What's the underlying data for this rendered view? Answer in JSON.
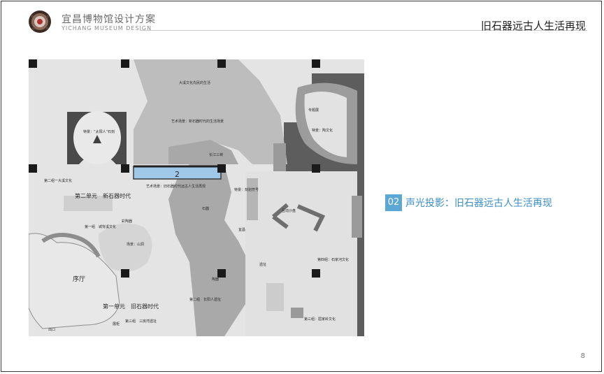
{
  "header": {
    "brand_cn": "宜昌博物馆设计方案",
    "brand_en": "YICHANG MUSEUM DESIGN",
    "title": "旧石器远古人生活再现"
  },
  "floorplan": {
    "labels": {
      "lobby": "序厅",
      "unit1": "第一单元　旧石器时代",
      "unit2": "第二单元　新石器时代",
      "unit2_sec1": "第二组一大溪文化",
      "site_marker": "2",
      "big_scene": "特景：“太阳人”石刻",
      "scene_carving": "特景：刻划符号",
      "scene_quju": "特景：陶文化",
      "group1_sec": "第一组　城背溪文化",
      "group3_sec": "第三组　三房湾遗址",
      "group3b": "第三组：屈家岭文化",
      "group5": "第四组：石家河文化",
      "art_scene": "艺术场景：旧石器时代远古人生活再现",
      "art_scene2": "艺术场景：新石器时代的生活场景",
      "changyang": "第二组　长阳人遗址",
      "painted_pottery": "彩陶器",
      "cave": "场景：山洞",
      "sandbox": "互动沙盘",
      "project": "专题展",
      "daxi_life": "大溪文化先民的生活",
      "river_scene": "长江三峡",
      "stone_tools": "石器",
      "pottery": "陶器",
      "ruins": "遗址",
      "yichang_map": "宜昌",
      "exit": "出口",
      "display": "展柜"
    }
  },
  "callout": {
    "number": "02",
    "text": "声光投影：旧石器远古人生活再现"
  },
  "page": {
    "number": "8"
  }
}
